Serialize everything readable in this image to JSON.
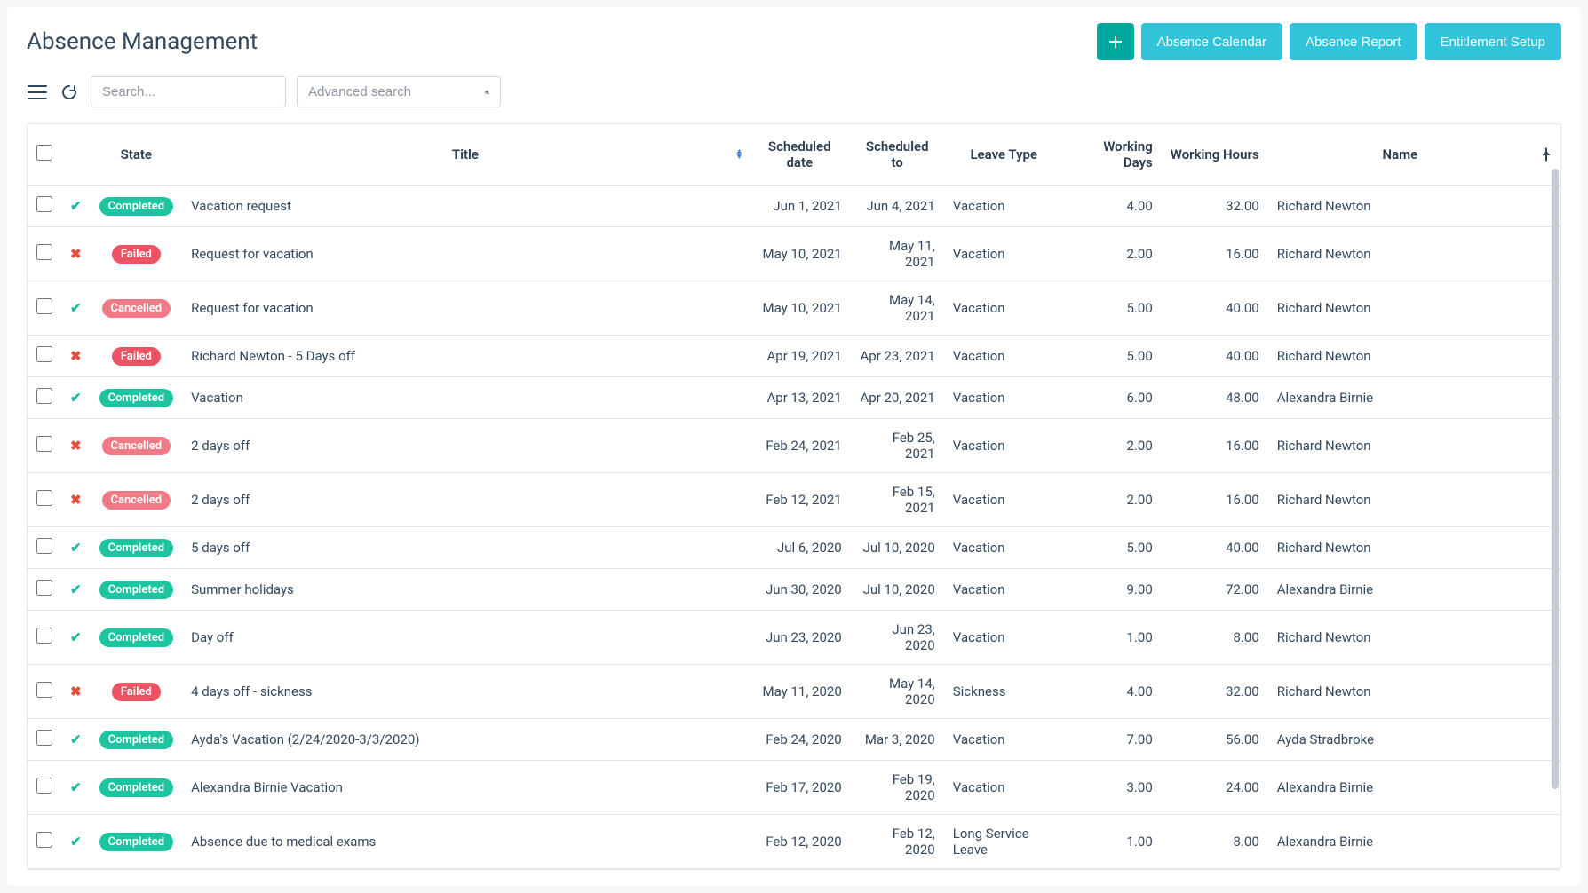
{
  "page": {
    "title": "Absence Management"
  },
  "actions": {
    "add_icon": "+",
    "calendar": "Absence Calendar",
    "report": "Absence Report",
    "entitlement": "Entitlement Setup"
  },
  "search": {
    "placeholder": "Search...",
    "advanced": "Advanced search"
  },
  "columns": {
    "state": "State",
    "title": "Title",
    "scheduled_date": "Scheduled date",
    "scheduled_to": "Scheduled to",
    "leave_type": "Leave Type",
    "working_days": "Working Days",
    "working_hours": "Working Hours",
    "name": "Name"
  },
  "rows": [
    {
      "status": "check",
      "state": "Completed",
      "title": "Vacation request",
      "scheduled_date": "Jun 1, 2021",
      "scheduled_to": "Jun 4, 2021",
      "leave_type": "Vacation",
      "working_days": "4.00",
      "working_hours": "32.00",
      "name": "Richard Newton"
    },
    {
      "status": "x",
      "state": "Failed",
      "title": "Request for vacation",
      "scheduled_date": "May 10, 2021",
      "scheduled_to": "May 11, 2021",
      "leave_type": "Vacation",
      "working_days": "2.00",
      "working_hours": "16.00",
      "name": "Richard Newton"
    },
    {
      "status": "check",
      "state": "Cancelled",
      "title": "Request for vacation",
      "scheduled_date": "May 10, 2021",
      "scheduled_to": "May 14, 2021",
      "leave_type": "Vacation",
      "working_days": "5.00",
      "working_hours": "40.00",
      "name": "Richard Newton"
    },
    {
      "status": "x",
      "state": "Failed",
      "title": "Richard Newton - 5 Days off",
      "scheduled_date": "Apr 19, 2021",
      "scheduled_to": "Apr 23, 2021",
      "leave_type": "Vacation",
      "working_days": "5.00",
      "working_hours": "40.00",
      "name": "Richard Newton"
    },
    {
      "status": "check",
      "state": "Completed",
      "title": "Vacation",
      "scheduled_date": "Apr 13, 2021",
      "scheduled_to": "Apr 20, 2021",
      "leave_type": "Vacation",
      "working_days": "6.00",
      "working_hours": "48.00",
      "name": "Alexandra Birnie"
    },
    {
      "status": "x",
      "state": "Cancelled",
      "title": "2 days off",
      "scheduled_date": "Feb 24, 2021",
      "scheduled_to": "Feb 25, 2021",
      "leave_type": "Vacation",
      "working_days": "2.00",
      "working_hours": "16.00",
      "name": "Richard Newton"
    },
    {
      "status": "x",
      "state": "Cancelled",
      "title": "2 days off",
      "scheduled_date": "Feb 12, 2021",
      "scheduled_to": "Feb 15, 2021",
      "leave_type": "Vacation",
      "working_days": "2.00",
      "working_hours": "16.00",
      "name": "Richard Newton"
    },
    {
      "status": "check",
      "state": "Completed",
      "title": "5 days off",
      "scheduled_date": "Jul 6, 2020",
      "scheduled_to": "Jul 10, 2020",
      "leave_type": "Vacation",
      "working_days": "5.00",
      "working_hours": "40.00",
      "name": "Richard Newton"
    },
    {
      "status": "check",
      "state": "Completed",
      "title": "Summer holidays",
      "scheduled_date": "Jun 30, 2020",
      "scheduled_to": "Jul 10, 2020",
      "leave_type": "Vacation",
      "working_days": "9.00",
      "working_hours": "72.00",
      "name": "Alexandra Birnie"
    },
    {
      "status": "check",
      "state": "Completed",
      "title": "Day off",
      "scheduled_date": "Jun 23, 2020",
      "scheduled_to": "Jun 23, 2020",
      "leave_type": "Vacation",
      "working_days": "1.00",
      "working_hours": "8.00",
      "name": "Richard Newton"
    },
    {
      "status": "x",
      "state": "Failed",
      "title": "4 days off - sickness",
      "scheduled_date": "May 11, 2020",
      "scheduled_to": "May 14, 2020",
      "leave_type": "Sickness",
      "working_days": "4.00",
      "working_hours": "32.00",
      "name": "Richard Newton"
    },
    {
      "status": "check",
      "state": "Completed",
      "title": "Ayda's Vacation (2/24/2020-3/3/2020)",
      "scheduled_date": "Feb 24, 2020",
      "scheduled_to": "Mar 3, 2020",
      "leave_type": "Vacation",
      "working_days": "7.00",
      "working_hours": "56.00",
      "name": "Ayda Stradbroke"
    },
    {
      "status": "check",
      "state": "Completed",
      "title": "Alexandra Birnie Vacation",
      "scheduled_date": "Feb 17, 2020",
      "scheduled_to": "Feb 19, 2020",
      "leave_type": "Vacation",
      "working_days": "3.00",
      "working_hours": "24.00",
      "name": "Alexandra Birnie"
    },
    {
      "status": "check",
      "state": "Completed",
      "title": "Absence due to medical exams",
      "scheduled_date": "Feb 12, 2020",
      "scheduled_to": "Feb 12, 2020",
      "leave_type": "Long Service Leave",
      "working_days": "1.00",
      "working_hours": "8.00",
      "name": "Alexandra Birnie"
    }
  ]
}
